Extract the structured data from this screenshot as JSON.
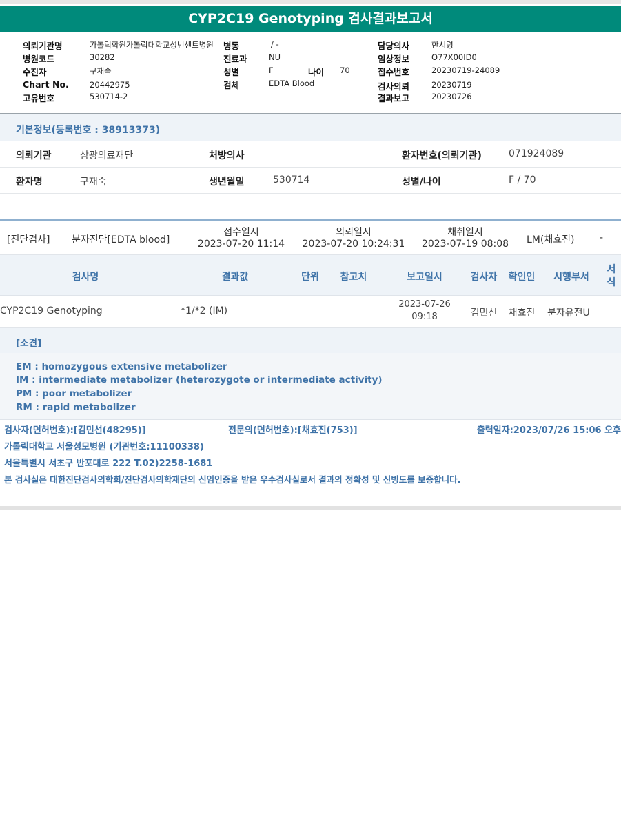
{
  "title": "CYP2C19 Genotyping 검사결과보고서",
  "header": {
    "col1": [
      {
        "label": "의뢰기관명",
        "value": "가톨릭학원가톨릭대학교성빈센트병원"
      },
      {
        "label": "병원코드",
        "value": "30282"
      },
      {
        "label": "수진자",
        "value": "구재숙"
      },
      {
        "label": "Chart No.",
        "value": "20442975"
      },
      {
        "label": "고유번호",
        "value": "530714-2"
      }
    ],
    "col2": [
      {
        "label": "병동",
        "value": "/ -"
      },
      {
        "label": "진료과",
        "value": "NU"
      },
      {
        "label": "성별",
        "value": "F"
      },
      {
        "label": "검체",
        "value": "EDTA Blood"
      }
    ],
    "age": {
      "label": "나이",
      "value": "70"
    },
    "col3": [
      {
        "label": "담당의사",
        "value": "한시령"
      },
      {
        "label": "임상정보",
        "value": "O77X00ID0"
      },
      {
        "label": "접수번호",
        "value": "20230719-24089"
      },
      {
        "label": "검사의뢰",
        "value": "20230719"
      },
      {
        "label": "결과보고",
        "value": "20230726"
      }
    ]
  },
  "basic_info": {
    "title": "기본정보(등록번호 : 38913373)",
    "row1": {
      "inst_label": "의뢰기관",
      "inst_value": "삼광의료재단",
      "doctor_label": "처방의사",
      "doctor_value": "",
      "patient_no_label": "환자번호(의뢰기관)",
      "patient_no_value": "071924089"
    },
    "row2": {
      "name_label": "환자명",
      "name_value": "구재숙",
      "birth_label": "생년월일",
      "birth_value": "530714",
      "sex_age_label": "성별/나이",
      "sex_age_value": "F / 70"
    }
  },
  "order": {
    "category": "[진단검사]",
    "test_group": "분자진단[EDTA blood]",
    "received_label": "접수일시",
    "received_value": "2023-07-20 11:14",
    "requested_label": "의뢰일시",
    "requested_value": "2023-07-20 10:24:31",
    "collected_label": "채취일시",
    "collected_value": "2023-07-19 08:08",
    "lm": "LM(채효진)",
    "dash": "-"
  },
  "table": {
    "headers": {
      "test_name": "검사명",
      "result": "결과값",
      "unit": "단위",
      "reference": "참고치",
      "report_time": "보고일시",
      "tester": "검사자",
      "confirmer": "확인인",
      "dept": "시행부서",
      "format_1": "서",
      "format_2": "식"
    },
    "rows": [
      {
        "test_name": "CYP2C19 Genotyping",
        "result": "*1/*2 (IM)",
        "unit": "",
        "reference": "",
        "report_date": "2023-07-26",
        "report_time": "09:18",
        "tester": "김민선",
        "confirmer": "채효진",
        "dept": "분자유전U"
      }
    ]
  },
  "opinion": {
    "title": "[소견]",
    "lines": [
      "EM : homozygous extensive metabolizer",
      "IM  : intermediate metabolizer (heterozygote or intermediate activity)",
      "PM : poor metabolizer",
      "RM : rapid metabolizer"
    ]
  },
  "footer": {
    "tester": "검사자(면허번호):[김민선(48295)]",
    "specialist": "전문의(면허번호):[채효진(753)]",
    "printed": "출력일자:2023/07/26 15:06 오후",
    "hospital": "가톨릭대학교 서울성모병원 (기관번호:11100338)",
    "address": "서울특별시 서초구 반포대로 222 T.02)2258-1681",
    "certification": "본 검사실은 대한진단검사의학회/진단검사의학재단의 신임인증을 받은 우수검사실로서 결과의 정확성 및 신빙도를 보증합니다."
  }
}
